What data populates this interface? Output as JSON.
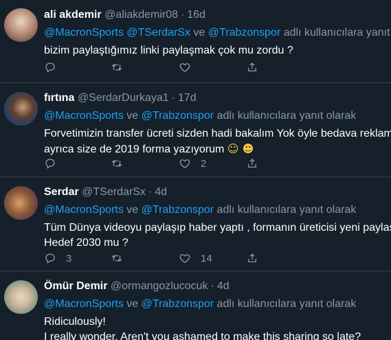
{
  "tweets": [
    {
      "name": "ali akdemir",
      "handle": "@aliakdemir08",
      "separator": "·",
      "time": "16d",
      "reply_parts": [
        "@MacronSports",
        " ",
        "@TSerdarSx",
        " ve ",
        "@Trabzonspor",
        " adlı kullanıcılara yanıt olarak"
      ],
      "body_lines": [
        "bizim paylaştığımız linki paylaşmak çok mu zordu ?"
      ],
      "reply_count": "",
      "retweet_count": "",
      "like_count": ""
    },
    {
      "name": "fırtına",
      "handle": "@SerdarDurkaya1",
      "separator": "·",
      "time": "17d",
      "reply_parts": [
        "@MacronSports",
        " ve ",
        "@Trabzonspor",
        " adlı kullanıcılara yanıt olarak"
      ],
      "body_lines": [
        "Forvetimizin transfer ücreti sizden hadi bakalım Yok öyle bedava reklam",
        "ayrıca size de 2019 forma yazıyorum"
      ],
      "emojis": "☺ ☻",
      "reply_count": "",
      "retweet_count": "",
      "like_count": "2"
    },
    {
      "name": "Serdar",
      "handle": "@TSerdarSx",
      "separator": "·",
      "time": "4d",
      "reply_parts": [
        "@MacronSports",
        " ve ",
        "@Trabzonspor",
        " adlı kullanıcılara yanıt olarak"
      ],
      "body_lines": [
        "Tüm Dünya videoyu paylaşıp haber yaptı , formanın üreticisi yeni paylaşıyor",
        "Hedef 2030 mu ?"
      ],
      "reply_count": "3",
      "retweet_count": "",
      "like_count": "14"
    },
    {
      "name": "Ömür Demir",
      "handle": "@ormangozlucocuk",
      "separator": "·",
      "time": "4d",
      "reply_parts": [
        "@MacronSports",
        " ve ",
        "@Trabzonspor",
        " adlı kullanıcılara yanıt olarak"
      ],
      "body_lines": [
        "Ridiculously!",
        "I really wonder. Aren't you ashamed to make this sharing so late?"
      ]
    }
  ],
  "icons": {
    "reply": "reply-icon",
    "retweet": "retweet-icon",
    "like": "heart-icon",
    "share": "share-icon"
  },
  "colors": {
    "background": "#15202b",
    "accent": "#1da1f2",
    "secondary_text": "#8899a6",
    "divider": "#38444d"
  }
}
